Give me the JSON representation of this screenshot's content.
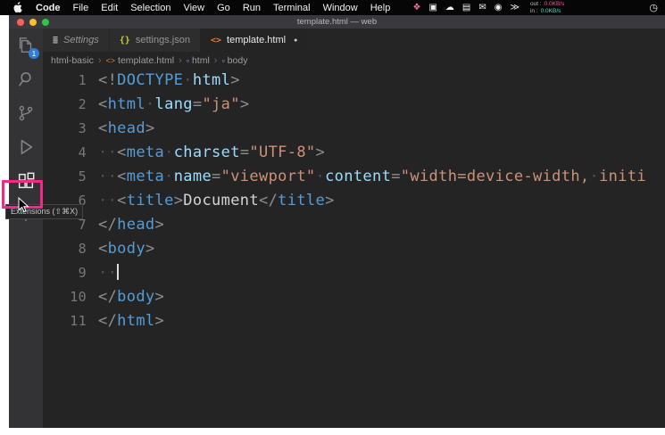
{
  "colors": {
    "tag": "#569cd6",
    "attr": "#9cdcfe",
    "string": "#ce9178",
    "punct": "#8f8f8f",
    "text": "#d4d4d4",
    "ws": "#505156",
    "pink": "#ef2a87",
    "badge": "#2f7fd6"
  },
  "menubar": {
    "menus": [
      {
        "label": "Code",
        "bold": true
      },
      {
        "label": "File"
      },
      {
        "label": "Edit"
      },
      {
        "label": "Selection"
      },
      {
        "label": "View"
      },
      {
        "label": "Go"
      },
      {
        "label": "Run"
      },
      {
        "label": "Terminal"
      },
      {
        "label": "Window"
      },
      {
        "label": "Help"
      }
    ],
    "status_icons": [
      {
        "name": "bowtie-status-icon",
        "glyph": "❖",
        "color": "#ff6fae"
      },
      {
        "name": "photos-status-icon",
        "glyph": "▣",
        "color": "#f0f0f0"
      },
      {
        "name": "cloud-status-icon",
        "glyph": "☁",
        "color": "#f0f0f0"
      },
      {
        "name": "notes-status-icon",
        "glyph": "▤",
        "color": "#f0f0f0"
      },
      {
        "name": "mail-status-icon",
        "glyph": "✉",
        "color": "#f0f0f0"
      },
      {
        "name": "user-status-icon",
        "glyph": "◉",
        "color": "#f0f0f0"
      },
      {
        "name": "chevrons-status-icon",
        "glyph": "≫",
        "color": "#f0f0f0"
      }
    ],
    "network": {
      "out_label": "out :",
      "out_value": "0.0KB/s",
      "in_label": "in :",
      "in_value": "0.0KB/s"
    },
    "clock_glyph": "◷"
  },
  "window": {
    "title": "template.html — web"
  },
  "activity_bar": {
    "badge": "1",
    "tooltip": "Extensions (⇧⌘X)"
  },
  "tabs": [
    {
      "icon": "≣",
      "icon_color": "#c0c0c0",
      "label": "Settings",
      "active": false,
      "italic": true,
      "modified": false
    },
    {
      "icon": "{}",
      "icon_color": "#cbcb41",
      "label": "settings.json",
      "active": false,
      "italic": false,
      "modified": false
    },
    {
      "icon": "<>",
      "icon_color": "#e37933",
      "label": "template.html",
      "active": true,
      "italic": false,
      "modified": true
    }
  ],
  "breadcrumb": [
    {
      "label": "html-basic"
    },
    {
      "icon": "<>",
      "icon_color": "#e37933",
      "label": "template.html"
    },
    {
      "icon": "▫",
      "icon_color": "#75beff",
      "label": "html"
    },
    {
      "icon": "▫",
      "icon_color": "#75beff",
      "label": "body"
    }
  ],
  "code": {
    "lines": [
      {
        "n": 1,
        "tk": [
          [
            "p",
            "<!"
          ],
          [
            "t",
            "DOCTYPE"
          ],
          [
            "w",
            "·"
          ],
          [
            "a",
            "html"
          ],
          [
            "p",
            ">"
          ]
        ]
      },
      {
        "n": 2,
        "tk": [
          [
            "p",
            "<"
          ],
          [
            "t",
            "html"
          ],
          [
            "w",
            "·"
          ],
          [
            "a",
            "lang"
          ],
          [
            "p",
            "="
          ],
          [
            "s",
            "\"ja\""
          ],
          [
            "p",
            ">"
          ]
        ]
      },
      {
        "n": 3,
        "tk": [
          [
            "p",
            "<"
          ],
          [
            "t",
            "head"
          ],
          [
            "p",
            ">"
          ]
        ]
      },
      {
        "n": 4,
        "tk": [
          [
            "w",
            "··"
          ],
          [
            "p",
            "<"
          ],
          [
            "t",
            "meta"
          ],
          [
            "w",
            "·"
          ],
          [
            "a",
            "charset"
          ],
          [
            "p",
            "="
          ],
          [
            "s",
            "\"UTF-8\""
          ],
          [
            "p",
            ">"
          ]
        ]
      },
      {
        "n": 5,
        "tk": [
          [
            "w",
            "··"
          ],
          [
            "p",
            "<"
          ],
          [
            "t",
            "meta"
          ],
          [
            "w",
            "·"
          ],
          [
            "a",
            "name"
          ],
          [
            "p",
            "="
          ],
          [
            "s",
            "\"viewport\""
          ],
          [
            "w",
            "·"
          ],
          [
            "a",
            "content"
          ],
          [
            "p",
            "="
          ],
          [
            "s",
            "\"width=device-width,"
          ],
          [
            "w",
            "·"
          ],
          [
            "s",
            "initi"
          ]
        ]
      },
      {
        "n": 6,
        "tk": [
          [
            "w",
            "··"
          ],
          [
            "p",
            "<"
          ],
          [
            "t",
            "title"
          ],
          [
            "p",
            ">"
          ],
          [
            "x",
            "Document"
          ],
          [
            "p",
            "</"
          ],
          [
            "t",
            "title"
          ],
          [
            "p",
            ">"
          ]
        ]
      },
      {
        "n": 7,
        "tk": [
          [
            "p",
            "</"
          ],
          [
            "t",
            "head"
          ],
          [
            "p",
            ">"
          ]
        ]
      },
      {
        "n": 8,
        "tk": [
          [
            "p",
            "<"
          ],
          [
            "t",
            "body"
          ],
          [
            "p",
            ">"
          ]
        ]
      },
      {
        "n": 9,
        "cursor": true,
        "tk": [
          [
            "w",
            "··"
          ]
        ]
      },
      {
        "n": 10,
        "tk": [
          [
            "p",
            "</"
          ],
          [
            "t",
            "body"
          ],
          [
            "p",
            ">"
          ]
        ]
      },
      {
        "n": 11,
        "tk": [
          [
            "p",
            "</"
          ],
          [
            "t",
            "html"
          ],
          [
            "p",
            ">"
          ]
        ]
      }
    ]
  }
}
